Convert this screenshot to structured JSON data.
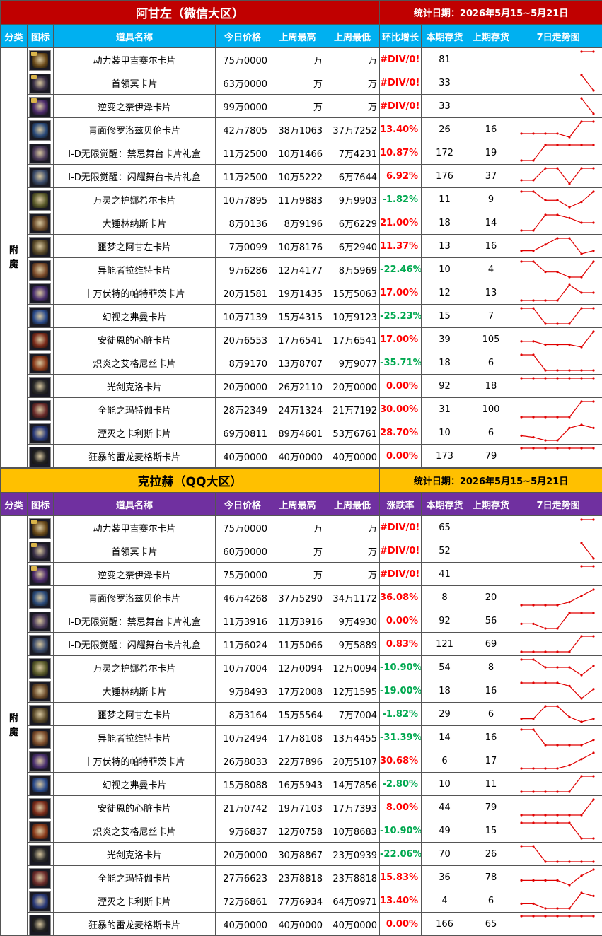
{
  "colors": {
    "wechat_title_bg": "#c00000",
    "wechat_header_bg": "#00b0f0",
    "qq_title_bg": "#ffc000",
    "qq_header_bg": "#7030a0",
    "up": "#ff0000",
    "down": "#00a84f",
    "trend_line": "#e00000"
  },
  "wechat": {
    "title": "阿甘左（微信大区）",
    "date": "统计日期：2026年5月15~5月21日",
    "headers": [
      "分类",
      "图标",
      "道具名称",
      "今日价格",
      "上周最高",
      "上周最低",
      "环比增长",
      "本期存货",
      "上期存货",
      "7日走势图"
    ],
    "category": "附魔",
    "rows": [
      {
        "name": "动力装甲吉赛尔卡片",
        "today": "75万0000",
        "high": "万",
        "low": "万",
        "pct": "#DIV/0!",
        "pct_dir": "up",
        "stock": "81",
        "prev": "",
        "trend": [
          null,
          null,
          null,
          null,
          null,
          1,
          1
        ]
      },
      {
        "name": "首领冥卡片",
        "today": "63万0000",
        "high": "万",
        "low": "万",
        "pct": "#DIV/0!",
        "pct_dir": "up",
        "stock": "33",
        "prev": "",
        "trend": [
          null,
          null,
          null,
          null,
          null,
          3,
          0
        ]
      },
      {
        "name": "逆变之奈伊泽卡片",
        "today": "99万0000",
        "high": "万",
        "low": "万",
        "pct": "#DIV/0!",
        "pct_dir": "up",
        "stock": "33",
        "prev": "",
        "trend": [
          null,
          null,
          null,
          null,
          null,
          3,
          0
        ]
      },
      {
        "name": "青面修罗洛兹贝伦卡片",
        "today": "42万7805",
        "high": "38万1063",
        "low": "37万7252",
        "pct": "13.40%",
        "pct_dir": "up",
        "stock": "26",
        "prev": "16",
        "trend": [
          0,
          0,
          0,
          0,
          -0.3,
          1,
          1
        ]
      },
      {
        "name": "I-D无限觉醒：禁忌舞台卡片礼盒",
        "today": "11万2500",
        "high": "10万1466",
        "low": "7万4231",
        "pct": "10.87%",
        "pct_dir": "up",
        "stock": "172",
        "prev": "19",
        "trend": [
          0,
          0,
          1,
          1,
          1,
          1,
          1
        ]
      },
      {
        "name": "I-D无限觉醒：闪耀舞台卡片礼盒",
        "today": "11万2500",
        "high": "10万5222",
        "low": "6万7644",
        "pct": "6.92%",
        "pct_dir": "up",
        "stock": "176",
        "prev": "37",
        "trend": [
          0,
          0,
          1,
          1,
          -0.3,
          1,
          1
        ]
      },
      {
        "name": "万灵之护娜希尔卡片",
        "today": "10万7895",
        "high": "11万9883",
        "low": "9万9903",
        "pct": "-1.82%",
        "pct_dir": "down",
        "stock": "11",
        "prev": "9",
        "trend": [
          1,
          1,
          0.5,
          0.5,
          0.1,
          0.4,
          1
        ]
      },
      {
        "name": "大锤林纳斯卡片",
        "today": "8万0136",
        "high": "8万9196",
        "low": "6万6229",
        "pct": "21.00%",
        "pct_dir": "up",
        "stock": "18",
        "prev": "14",
        "trend": [
          0,
          0,
          1,
          1,
          0.8,
          0.5,
          0.5
        ]
      },
      {
        "name": "噩梦之阿甘左卡片",
        "today": "7万0099",
        "high": "10万8176",
        "low": "6万2940",
        "pct": "11.37%",
        "pct_dir": "up",
        "stock": "13",
        "prev": "16",
        "trend": [
          0.2,
          0.2,
          0.6,
          1,
          1,
          0,
          0.2
        ]
      },
      {
        "name": "异能者拉维特卡片",
        "today": "9万6286",
        "high": "12万4177",
        "low": "8万5969",
        "pct": "-22.46%",
        "pct_dir": "down",
        "stock": "10",
        "prev": "4",
        "trend": [
          1,
          1,
          0.4,
          0.4,
          0.1,
          0.1,
          1
        ]
      },
      {
        "name": "十万伏特的帕特菲茨卡片",
        "today": "20万1581",
        "high": "19万1435",
        "low": "15万5063",
        "pct": "17.00%",
        "pct_dir": "up",
        "stock": "12",
        "prev": "13",
        "trend": [
          0,
          0,
          0,
          0,
          1,
          0.5,
          0.5
        ]
      },
      {
        "name": "幻视之弗曼卡片",
        "today": "10万7139",
        "high": "15万4315",
        "low": "10万9123",
        "pct": "-25.23%",
        "pct_dir": "down",
        "stock": "15",
        "prev": "7",
        "trend": [
          1,
          1,
          0,
          0,
          0,
          1,
          1
        ]
      },
      {
        "name": "安徒恩的心脏卡片",
        "today": "20万6553",
        "high": "17万6541",
        "low": "17万6541",
        "pct": "17.00%",
        "pct_dir": "up",
        "stock": "39",
        "prev": "105",
        "trend": [
          0.4,
          0.4,
          0.2,
          0.2,
          0.2,
          0.05,
          1
        ]
      },
      {
        "name": "炽炎之艾格尼丝卡片",
        "today": "8万9170",
        "high": "13万8707",
        "low": "9万9077",
        "pct": "-35.71%",
        "pct_dir": "down",
        "stock": "18",
        "prev": "6",
        "trend": [
          1,
          1,
          0,
          0,
          0,
          0,
          0
        ]
      },
      {
        "name": "光剑克洛卡片",
        "today": "20万0000",
        "high": "26万2110",
        "low": "20万0000",
        "pct": "0.00%",
        "pct_dir": "up",
        "stock": "92",
        "prev": "18",
        "trend": [
          1,
          1,
          1,
          1,
          1,
          1,
          1
        ]
      },
      {
        "name": "全能之玛特伽卡片",
        "today": "28万2349",
        "high": "24万1324",
        "low": "21万7192",
        "pct": "30.00%",
        "pct_dir": "up",
        "stock": "31",
        "prev": "100",
        "trend": [
          0,
          0,
          0,
          0,
          0,
          1,
          1
        ]
      },
      {
        "name": "湮灭之卡利斯卡片",
        "today": "69万0811",
        "high": "89万4601",
        "low": "53万6761",
        "pct": "28.70%",
        "pct_dir": "up",
        "stock": "10",
        "prev": "6",
        "trend": [
          0.3,
          0.2,
          0,
          0,
          0.8,
          1,
          0.8
        ]
      },
      {
        "name": "狂暴的雷龙麦格斯卡片",
        "today": "40万0000",
        "high": "40万0000",
        "low": "40万0000",
        "pct": "0.00%",
        "pct_dir": "up",
        "stock": "173",
        "prev": "79",
        "trend": [
          1,
          1,
          1,
          1,
          1,
          1,
          1
        ]
      }
    ]
  },
  "qq": {
    "title": "克拉赫（QQ大区）",
    "date": "统计日期：2026年5月15~5月21日",
    "headers": [
      "分类",
      "图标",
      "道具名称",
      "今日价格",
      "上周最高",
      "上周最低",
      "涨跌率",
      "本期存货",
      "上期存货",
      "7日走势图"
    ],
    "category": "附魔",
    "rows": [
      {
        "name": "动力装甲吉赛尔卡片",
        "today": "75万0000",
        "high": "万",
        "low": "万",
        "pct": "#DIV/0!",
        "pct_dir": "up",
        "stock": "65",
        "prev": "",
        "trend": [
          null,
          null,
          null,
          null,
          null,
          1,
          1
        ]
      },
      {
        "name": "首领冥卡片",
        "today": "60万0000",
        "high": "万",
        "low": "万",
        "pct": "#DIV/0!",
        "pct_dir": "up",
        "stock": "52",
        "prev": "",
        "trend": [
          null,
          null,
          null,
          null,
          null,
          3,
          0
        ]
      },
      {
        "name": "逆变之奈伊泽卡片",
        "today": "75万0000",
        "high": "万",
        "low": "万",
        "pct": "#DIV/0!",
        "pct_dir": "up",
        "stock": "41",
        "prev": "",
        "trend": [
          null,
          null,
          null,
          null,
          null,
          1,
          1
        ]
      },
      {
        "name": "青面修罗洛兹贝伦卡片",
        "today": "46万4268",
        "high": "37万5290",
        "low": "34万1172",
        "pct": "36.08%",
        "pct_dir": "up",
        "stock": "8",
        "prev": "20",
        "trend": [
          0,
          0,
          0,
          0,
          0.2,
          0.6,
          1
        ]
      },
      {
        "name": "I-D无限觉醒：禁忌舞台卡片礼盒",
        "today": "11万3916",
        "high": "11万3916",
        "low": "9万4930",
        "pct": "0.00%",
        "pct_dir": "up",
        "stock": "92",
        "prev": "56",
        "trend": [
          0.3,
          0.3,
          0,
          0,
          1,
          1,
          1
        ]
      },
      {
        "name": "I-D无限觉醒：闪耀舞台卡片礼盒",
        "today": "11万6024",
        "high": "11万5066",
        "low": "9万5889",
        "pct": "0.83%",
        "pct_dir": "up",
        "stock": "121",
        "prev": "69",
        "trend": [
          0,
          0,
          0,
          0,
          0,
          1,
          1
        ]
      },
      {
        "name": "万灵之护娜希尔卡片",
        "today": "10万7004",
        "high": "12万0094",
        "low": "12万0094",
        "pct": "-10.90%",
        "pct_dir": "down",
        "stock": "54",
        "prev": "8",
        "trend": [
          1,
          1,
          0.5,
          0.5,
          0.5,
          0,
          0.6
        ]
      },
      {
        "name": "大锤林纳斯卡片",
        "today": "9万8493",
        "high": "17万2008",
        "low": "12万1595",
        "pct": "-19.00%",
        "pct_dir": "down",
        "stock": "18",
        "prev": "16",
        "trend": [
          1,
          1,
          1,
          1,
          0.8,
          0,
          0.6
        ]
      },
      {
        "name": "噩梦之阿甘左卡片",
        "today": "8万3164",
        "high": "15万5564",
        "low": "7万7004",
        "pct": "-1.82%",
        "pct_dir": "down",
        "stock": "29",
        "prev": "6",
        "trend": [
          0.2,
          0.2,
          1,
          1,
          0.3,
          0,
          0.2
        ]
      },
      {
        "name": "异能者拉维特卡片",
        "today": "10万2494",
        "high": "17万8108",
        "low": "13万4455",
        "pct": "-31.39%",
        "pct_dir": "down",
        "stock": "14",
        "prev": "16",
        "trend": [
          1,
          1,
          0.4,
          0.4,
          0.4,
          0.4,
          0.6
        ]
      },
      {
        "name": "十万伏特的帕特菲茨卡片",
        "today": "26万8033",
        "high": "22万7896",
        "low": "20万5107",
        "pct": "30.68%",
        "pct_dir": "up",
        "stock": "6",
        "prev": "17",
        "trend": [
          0,
          0,
          0,
          0,
          0.2,
          0.6,
          1
        ]
      },
      {
        "name": "幻视之弗曼卡片",
        "today": "15万8088",
        "high": "16万5943",
        "low": "14万7856",
        "pct": "-2.80%",
        "pct_dir": "down",
        "stock": "10",
        "prev": "11",
        "trend": [
          0,
          0,
          0,
          0,
          0,
          1,
          1
        ]
      },
      {
        "name": "安徒恩的心脏卡片",
        "today": "21万0742",
        "high": "19万7103",
        "low": "17万7393",
        "pct": "8.00%",
        "pct_dir": "up",
        "stock": "44",
        "prev": "79",
        "trend": [
          0,
          0,
          0,
          0,
          0,
          0,
          1
        ]
      },
      {
        "name": "炽炎之艾格尼丝卡片",
        "today": "9万6837",
        "high": "12万0758",
        "low": "10万8683",
        "pct": "-10.90%",
        "pct_dir": "down",
        "stock": "49",
        "prev": "15",
        "trend": [
          1,
          1,
          1,
          1,
          1,
          0,
          0
        ]
      },
      {
        "name": "光剑克洛卡片",
        "today": "20万0000",
        "high": "30万8867",
        "low": "23万0939",
        "pct": "-22.06%",
        "pct_dir": "down",
        "stock": "70",
        "prev": "26",
        "trend": [
          1,
          1,
          0,
          0,
          0,
          0,
          0
        ]
      },
      {
        "name": "全能之玛特伽卡片",
        "today": "27万6623",
        "high": "23万8818",
        "low": "23万8818",
        "pct": "15.83%",
        "pct_dir": "up",
        "stock": "36",
        "prev": "78",
        "trend": [
          0.3,
          0.3,
          0.3,
          0.3,
          0,
          0.6,
          1
        ]
      },
      {
        "name": "湮灭之卡利斯卡片",
        "today": "72万6861",
        "high": "77万6934",
        "low": "64万0971",
        "pct": "13.40%",
        "pct_dir": "up",
        "stock": "4",
        "prev": "6",
        "trend": [
          0.3,
          0.3,
          0,
          0,
          0,
          1,
          0.8
        ]
      },
      {
        "name": "狂暴的雷龙麦格斯卡片",
        "today": "40万0000",
        "high": "40万0000",
        "low": "40万0000",
        "pct": "0.00%",
        "pct_dir": "up",
        "stock": "166",
        "prev": "65",
        "trend": [
          1,
          1,
          1,
          1,
          1,
          1,
          1
        ]
      }
    ]
  },
  "icons": [
    "gold-armor-card-icon",
    "dark-card-icon",
    "purple-card-icon",
    "blue-card-icon",
    "stage-box-icon",
    "stage-box-icon",
    "gold-card-icon",
    "bronze-card-icon",
    "gold-face-card-icon",
    "orange-card-icon",
    "purple-card-icon",
    "blue-card-icon",
    "red-card-icon",
    "orange-card-icon",
    "dark-card-icon",
    "red-card-icon",
    "blue-card-icon",
    "dark-card-icon"
  ]
}
